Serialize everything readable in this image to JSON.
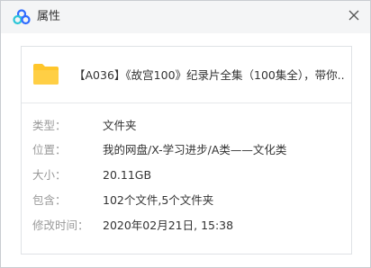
{
  "window": {
    "title": "属性",
    "logo_icon": "baidu-netdisk-cloud-icon",
    "close_icon": "close-icon"
  },
  "file": {
    "icon": "folder-icon",
    "name": "【A036】《故宫100》纪录片全集（100集全），带你..."
  },
  "properties": [
    {
      "label": "类型：",
      "value": "文件夹"
    },
    {
      "label": "位置：",
      "value": "我的网盘/X-学习进步/A类——文化类"
    },
    {
      "label": "大小：",
      "value": "20.11GB"
    },
    {
      "label": "包含：",
      "value": "102个文件,5个文件夹"
    },
    {
      "label": "修改时间：",
      "value": "2020年02月21日, 15:38"
    }
  ],
  "colors": {
    "logo_blue": "#2f6cff",
    "logo_cyan": "#2cc6d8",
    "folder_yellow": "#ffc62b",
    "label_gray": "#9a9a9a",
    "text_dark": "#333333"
  }
}
